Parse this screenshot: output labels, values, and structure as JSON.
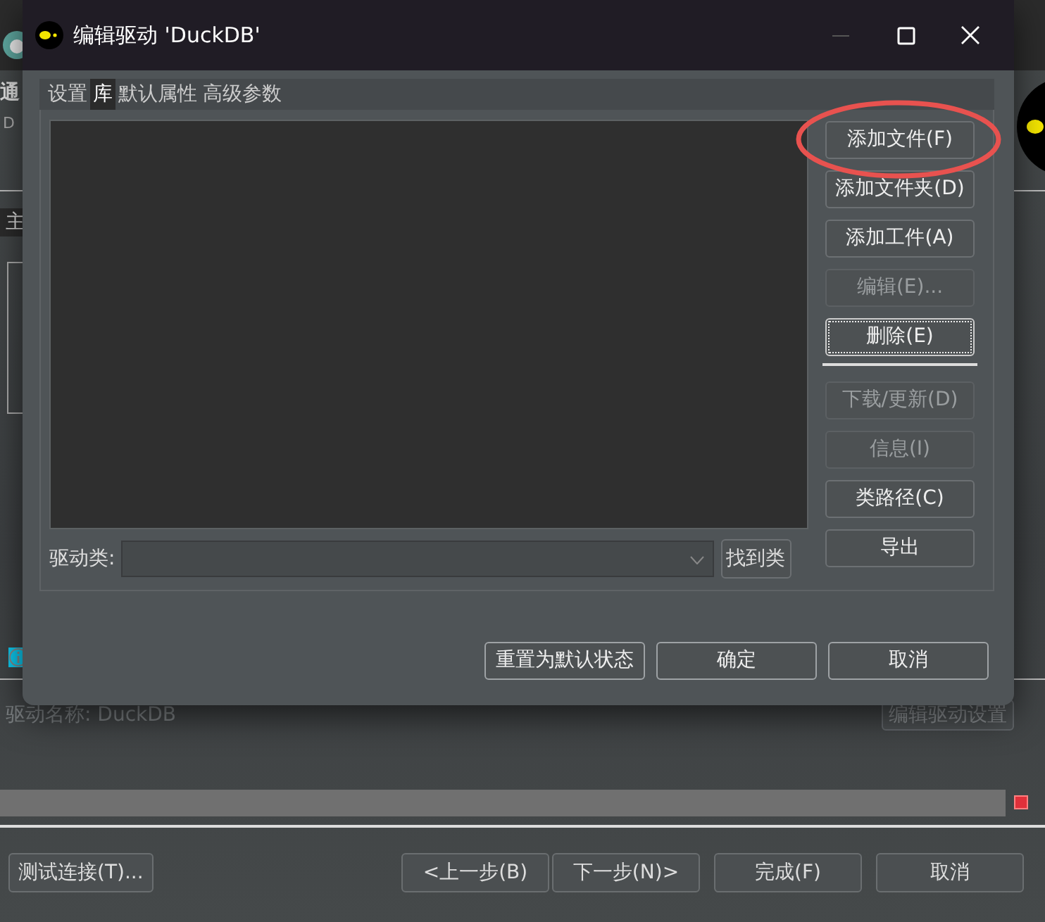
{
  "background_window": {
    "heading": "通",
    "subheading": "D",
    "tab": "主",
    "driver_name_label": "驱动名称:",
    "driver_name": "DuckDB",
    "edit_driver_button": "编辑驱动设置",
    "progress": {
      "level": 1
    },
    "buttons": [
      {
        "label": "测试连接(T)...",
        "kind": "left"
      },
      {
        "label": "<上一步(B)",
        "kind": "right"
      },
      {
        "label": "下一步(N)>",
        "kind": "right"
      },
      {
        "label": "完成(F)",
        "kind": "right"
      },
      {
        "label": "取消",
        "kind": "right"
      }
    ]
  },
  "dialog": {
    "title": "编辑驱动 'DuckDB'",
    "tabs": [
      {
        "label": "设置",
        "selected": false
      },
      {
        "label": "库",
        "selected": true
      },
      {
        "label": "默认属性",
        "selected": false
      },
      {
        "label": "高级参数",
        "selected": false
      }
    ],
    "side_buttons": [
      {
        "kind": "button",
        "label": "添加文件(F)",
        "disabled": false,
        "focused": false,
        "circled": true
      },
      {
        "kind": "button",
        "label": "添加文件夹(D)",
        "disabled": false,
        "focused": false,
        "circled": false
      },
      {
        "kind": "button",
        "label": "添加工件(A)",
        "disabled": false,
        "focused": false,
        "circled": false
      },
      {
        "kind": "button",
        "label": "编辑(E)...",
        "disabled": true,
        "focused": false,
        "circled": false
      },
      {
        "kind": "button",
        "label": "删除(E)",
        "disabled": false,
        "focused": true,
        "circled": false
      },
      {
        "kind": "separator"
      },
      {
        "kind": "button",
        "label": "下载/更新(D)",
        "disabled": true,
        "focused": false,
        "circled": false
      },
      {
        "kind": "button",
        "label": "信息(I)",
        "disabled": true,
        "focused": false,
        "circled": false
      },
      {
        "kind": "button",
        "label": "类路径(C)",
        "disabled": false,
        "focused": false,
        "circled": false
      },
      {
        "kind": "button",
        "label": "导出",
        "disabled": false,
        "focused": false,
        "circled": false
      }
    ],
    "driver_class_label": "驱动类:",
    "find_class_button": "找到类",
    "footer_buttons": [
      "重置为默认状态",
      "确定",
      "取消"
    ]
  }
}
